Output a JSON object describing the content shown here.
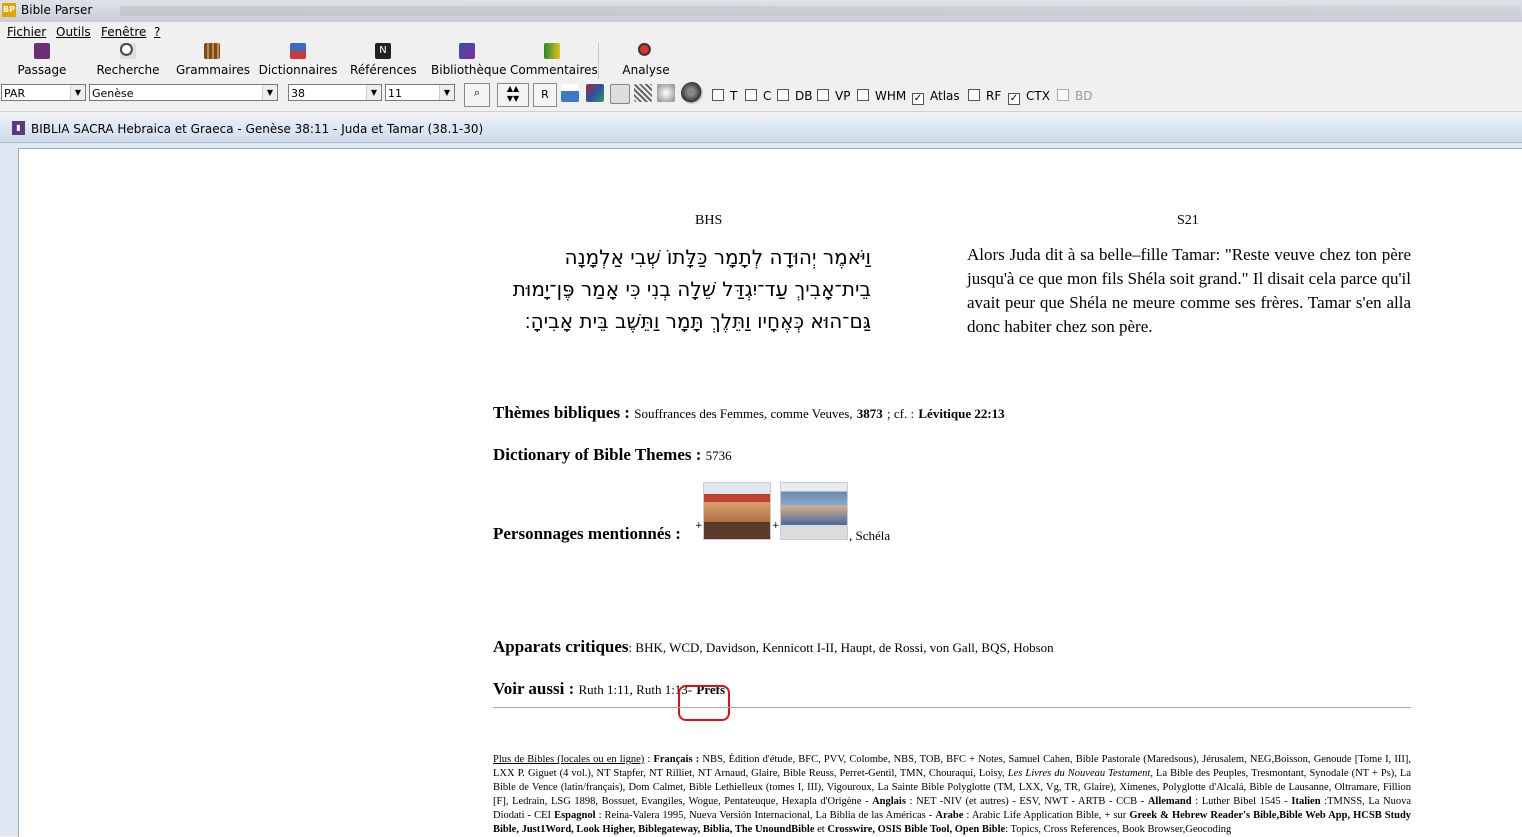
{
  "app": {
    "title": "Bible Parser"
  },
  "menu": [
    "Fichier",
    "Outils",
    "Fenêtre",
    "?"
  ],
  "toolbar": [
    "Passage",
    "Recherche",
    "Grammaires",
    "Dictionnaires",
    "Références",
    "Bibliothèque",
    "Commentaires",
    "Analyse"
  ],
  "selectors": {
    "version": "PAR",
    "book": "Genèse",
    "chapter": "38",
    "verse": "11",
    "r_button": "R"
  },
  "checkboxes": [
    {
      "label": "T",
      "checked": false,
      "enabled": true
    },
    {
      "label": "C",
      "checked": false,
      "enabled": true
    },
    {
      "label": "DB",
      "checked": false,
      "enabled": true
    },
    {
      "label": "VP",
      "checked": false,
      "enabled": true
    },
    {
      "label": "WHM",
      "checked": false,
      "enabled": true
    },
    {
      "label": "Atlas",
      "checked": true,
      "enabled": true
    },
    {
      "label": "RF",
      "checked": false,
      "enabled": true
    },
    {
      "label": "CTX",
      "checked": true,
      "enabled": true
    },
    {
      "label": "BD",
      "checked": false,
      "enabled": false
    }
  ],
  "window": {
    "title": "BIBLIA SACRA Hebraica et Graeca - Genèse 38:11 - Juda et Tamar (38.1-30)"
  },
  "columns": {
    "left": "BHS",
    "right": "S21"
  },
  "hebrew_lines": [
    "וַיֹּאמֶר יְהוּדָה לְתָמָר כַּלָּתוֹ שְׁבִי אַלְמָנָה",
    "בֵית־אָבִיךְ עַד־יִגְדַּל שֵׁלָה בְנִי כִּי אָמַר פֶּן־יָמוּת",
    "גַּם־הוּא כְּאֶחָיו וַתֵּלֶךְ תָּמָר וַתֵּשֶׁב בֵּית אָבִיהָ׃"
  ],
  "french": "Alors Juda dit à sa belle–fille Tamar: \"Reste veuve chez ton père jusqu'à ce que mon fils Shéla soit grand.\" Il disait cela parce qu'il avait peur que Shéla ne meure comme ses frères. Tamar s'en alla donc habiter chez son père.",
  "themes": {
    "label": "Thèmes bibliques :",
    "text": "Souffrances des Femmes, comme Veuves,",
    "num": "3873",
    "sep": "; cf. :",
    "ref": "Lévitique 22:13"
  },
  "dbt": {
    "label": "Dictionary of Bible Themes :",
    "num": "5736"
  },
  "persons": {
    "label": "Personnages mentionnés :",
    "plus1": "+",
    "plus2": "+",
    "tail": ", Schéla"
  },
  "apparats": {
    "label": "Apparats critiques",
    "text": ": BHK, WCD, Davidson, Kennicott I-II, Haupt, de Rossi, von Gall, BQS, Hobson"
  },
  "voir": {
    "label": "Voir aussi :",
    "text": "Ruth 1:11, Ruth 1:13",
    "dash": "-",
    "prefs": "Prefs"
  },
  "footer": {
    "link": "Plus de Bibles (locales ou en ligne)",
    "fr_label": "Français :",
    "fr_text": "NBS, Édition d'étude, BFC, PVV, Colombe, NBS, TOB, BFC + Notes, Samuel Cahen, Bible Pastorale (Maredsous), Jérusalem, NEG,Boisson, Genoude [Tome I, III], LXX P. Giguet (4 vol.), NT Stapfer, NT Rilliet, NT Arnaud, Glaire, Bible Reuss, Perret-Gentil, TMN, Chouraqui, Loisy,",
    "fr_italic": "Les Livres du Nouveau Testament,",
    "fr_text2": "La Bible des Peuples, Tresmontant, Synodale (NT + Ps), La Bible de Vence (latin/français), Dom Calmet, Bible Lethielleux (tomes I, III), Vigouroux, La Sainte Bible Polyglotte (TM, LXX, Vg, TR, Glaire), Ximenes, Polyglotte d'Alcalá, Bible de Lausanne, Oltramare, Fillion [F], Ledrain, LSG 1898, Bossuet, Evangiles, Wogue, Pentateuque, Hexapla d'Origène -",
    "en_label": "Anglais",
    "en_text": ": NET -NIV (et autres) - ESV, NWT - ARTB - CCB -",
    "de_label": "Allemand",
    "de_text": ": Luther Bibel 1545 -",
    "it_label": "Italien",
    "it_text": ":TMNSS, La Nuova Diodati - CEI",
    "es_label": "Espagnol",
    "es_text": ": Reina-Valera 1995, Nueva Versión Internacional, La Biblia de las Américas -",
    "ar_label": "Arabe",
    "ar_text": ": Arabic Life Application Bible, + sur",
    "sites": "Greek & Hebrew Reader's Bible,Bible Web App, HCSB Study Bible, Just1Word, Look Higher, Biblegateway, Biblia, The UnoundBible",
    "et": "et",
    "sites2": "Crosswire, OSIS Bible Tool, Open Bible",
    "tail": ": Topics, Cross References, Book Browser,Geocoding"
  }
}
